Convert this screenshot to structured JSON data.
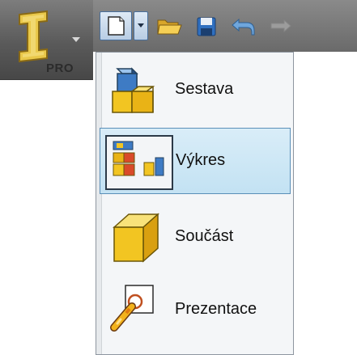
{
  "app_button": {
    "badge": "PRO"
  },
  "quick_access": {
    "icons": [
      "new-document-icon",
      "dropdown-arrow-icon",
      "open-folder-icon",
      "save-icon",
      "undo-icon",
      "redo-icon"
    ]
  },
  "new_menu": {
    "items": [
      {
        "label": "Sestava",
        "icon": "assembly-icon",
        "highlighted": false
      },
      {
        "label": "Výkres",
        "icon": "drawing-icon",
        "highlighted": true
      },
      {
        "label": "Součást",
        "icon": "part-icon",
        "highlighted": false
      },
      {
        "label": "Prezentace",
        "icon": "presentation-icon",
        "highlighted": false
      }
    ]
  },
  "colors": {
    "highlight": "#c3e2f3",
    "highlight_border": "#5a8fb8",
    "toolbar": "#6a6a6a",
    "icon_yellow": "#f2c522",
    "icon_blue": "#3e7bc4"
  }
}
